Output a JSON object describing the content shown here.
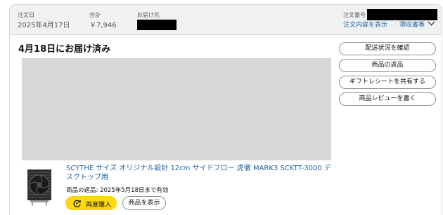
{
  "header": {
    "order_date_label": "注文日",
    "order_date": "2025年4月17日",
    "total_label": "合計",
    "total": "￥7,946",
    "ship_to_label": "お届け先",
    "order_number_label": "注文番号",
    "order_details_link": "注文内容を表示",
    "receipt_link": "領収書等"
  },
  "shipment": {
    "status_title": "4月18日にお届け済み"
  },
  "actions": {
    "track": "配送状況を確認",
    "return": "商品の返品",
    "gift_receipt": "ギフトレシートを共有する",
    "review": "商品レビューを書く"
  },
  "product": {
    "title": "SCYTHE サイズ オリジナル設計 12cm サイドフロー 虎徹 MARK3 SCKTT-3000 デスクトップ用",
    "return_info": "商品の返品: 2025年5月18日まで有効",
    "buy_again": "再度購入",
    "view_product": "商品を表示"
  },
  "colors": {
    "link": "#2162a1",
    "buy_again_bg": "#ffd814",
    "header_bg": "#f0f2f2"
  },
  "icons": {
    "buy_again": "buy-again-cycle-icon",
    "receipt_dropdown": "chevron-down-icon"
  }
}
